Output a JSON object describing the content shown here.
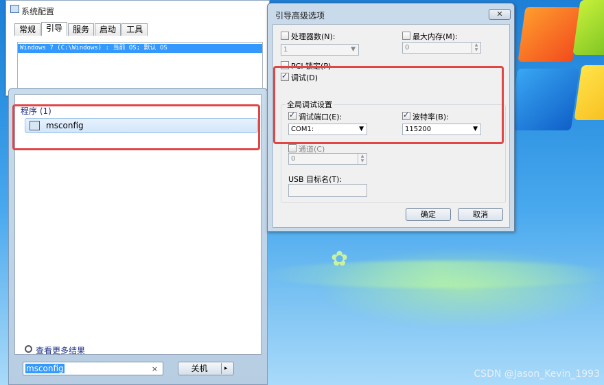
{
  "desktop": {
    "watermark": "CSDN @Jason_Kevin_1993"
  },
  "msconfig": {
    "title": "系统配置",
    "tabs": [
      "常规",
      "引导",
      "服务",
      "启动",
      "工具"
    ],
    "selected_tab": "引导",
    "boot_entry": "Windows 7 (C:\\Windows) : 当前 OS; 默认 OS"
  },
  "start_menu": {
    "programs_header": "程序 (1)",
    "program_item": "msconfig",
    "see_more": "查看更多结果",
    "search_value": "msconfig",
    "search_clear": "×",
    "shutdown_label": "关机",
    "shutdown_arrow": "▸"
  },
  "dialog": {
    "title": "引导高级选项",
    "close": "✕",
    "num_processors": {
      "label": "处理器数(N):",
      "checked": false,
      "value": "1"
    },
    "max_memory": {
      "label": "最大内存(M):",
      "checked": false,
      "value": "0"
    },
    "pci_lock": {
      "label": "PCI 锁定(P)",
      "checked": false
    },
    "debug": {
      "label": "调试(D)",
      "checked": true
    },
    "global_debug_header": "全局调试设置",
    "debug_port": {
      "label": "调试端口(E):",
      "checked": true,
      "value": "COM1:"
    },
    "baud_rate": {
      "label": "波特率(B):",
      "checked": true,
      "value": "115200"
    },
    "channel": {
      "label": "通道(C)",
      "checked": false,
      "value": "0"
    },
    "usb_target": {
      "label": "USB 目标名(T):",
      "value": ""
    },
    "ok": "确定",
    "cancel": "取消"
  },
  "colors": {
    "highlight": "#e04646",
    "selection": "#3399ff"
  }
}
